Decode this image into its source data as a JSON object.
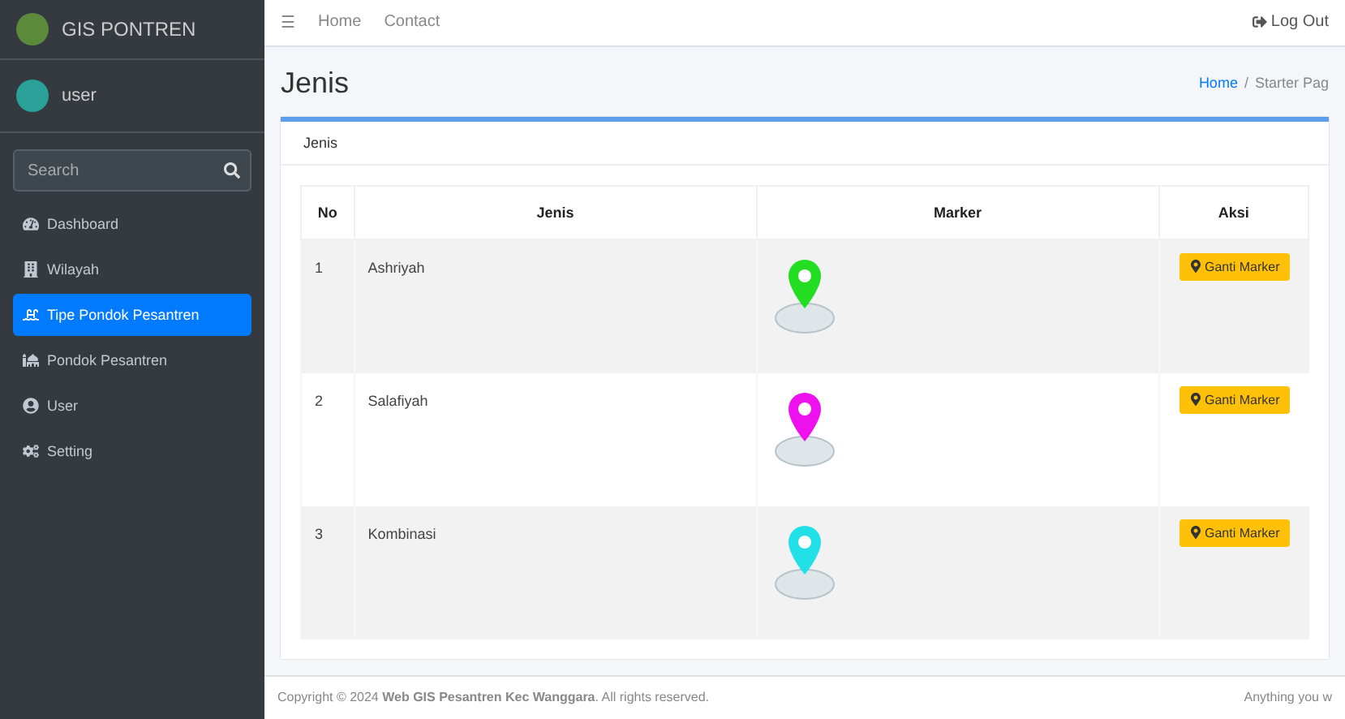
{
  "brand": {
    "name": "GIS PONTREN"
  },
  "user": {
    "name": "user"
  },
  "sidebar_search": {
    "placeholder": "Search"
  },
  "sidebar": {
    "items": [
      {
        "label": "Dashboard",
        "selected": false
      },
      {
        "label": "Wilayah",
        "selected": false
      },
      {
        "label": "Tipe Pondok Pesantren",
        "selected": true
      },
      {
        "label": "Pondok Pesantren",
        "selected": false
      },
      {
        "label": "User",
        "selected": false
      },
      {
        "label": "Setting",
        "selected": false
      }
    ]
  },
  "navbar": {
    "menu_icon": "☰",
    "links": [
      "Home",
      "Contact"
    ],
    "logout": "Log Out"
  },
  "page": {
    "title": "Jenis",
    "breadcrumb": {
      "link": "Home",
      "separator": "/",
      "current": "Starter Pag"
    }
  },
  "card": {
    "title": "Jenis",
    "table": {
      "columns": [
        "No",
        "Jenis",
        "Marker",
        "Aksi"
      ],
      "rows": [
        {
          "no": "1",
          "jenis": "Ashriyah",
          "color": "#22dd22",
          "action": "Ganti Marker"
        },
        {
          "no": "2",
          "jenis": "Salafiyah",
          "color": "#ee11ee",
          "action": "Ganti Marker"
        },
        {
          "no": "3",
          "jenis": "Kombinasi",
          "color": "#22e0e8",
          "action": "Ganti Marker"
        }
      ]
    }
  },
  "footer": {
    "text": "Copyright © 2024 **Web GIS Pesantren Kec Wanggara**. All rights reserved.",
    "right": "Anything you w"
  }
}
